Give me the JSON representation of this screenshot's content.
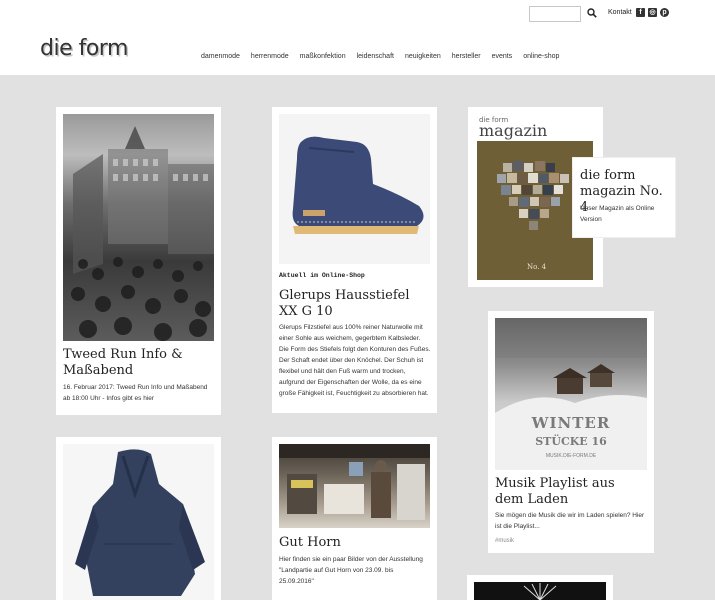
{
  "header": {
    "logo": "die form",
    "search": {
      "placeholder": ""
    },
    "contact_label": "Kontakt",
    "social": {
      "facebook": "f",
      "instagram": "◎",
      "pinterest": "p"
    },
    "nav": [
      "damenmode",
      "herrenmode",
      "maßkonfektion",
      "leidenschaft",
      "neuigkeiten",
      "hersteller",
      "events",
      "online-shop"
    ]
  },
  "cards": {
    "tweed": {
      "title": "Tweed Run Info & Maßabend",
      "text": "16. Februar 2017: Tweed Run Info und Maßabend ab 18:00 Uhr - Infos gibt es hier"
    },
    "boot": {
      "kicker": "Aktuell im Online-Shop",
      "title": "Glerups Hausstiefel XX G 10",
      "text": "Glerups Filzstiefel aus 100% reiner Naturwolle mit einer Sohle aus weichem, gegerbtem Kalbsleder. Die Form des Stiefels folgt den Konturen des Fußes.  Der Schaft endet über den Knöchel. Der Schuh ist flexibel und hält den Fuß warm und trocken, aufgrund der Eigenschaften der Wolle, da es eine große Fähigkeit ist, Feuchtigkeit zu absorbieren hat."
    },
    "magazine": {
      "cover_small": "die form",
      "cover_title": "magazin",
      "cover_number": "No. 4",
      "title": "die form magazin No. 4",
      "text": "Unser Magazin als Online Version"
    },
    "music": {
      "photo_line1": "WINTER",
      "photo_line2": "STÜCKE 16",
      "photo_line3": "MUSIK.DIE-FORM.DE",
      "title": "Musik Playlist aus dem Laden",
      "text": "Sie mögen die Musik die wir im Laden spielen? Hier ist die Playlist...",
      "tag": "#musik"
    },
    "horn": {
      "title": "Gut Horn",
      "text": "Hier finden sie ein paar Bilder von der Ausstellung \"Landpartie auf Gut Horn von 23.09. bis 25.09.2016\""
    }
  }
}
